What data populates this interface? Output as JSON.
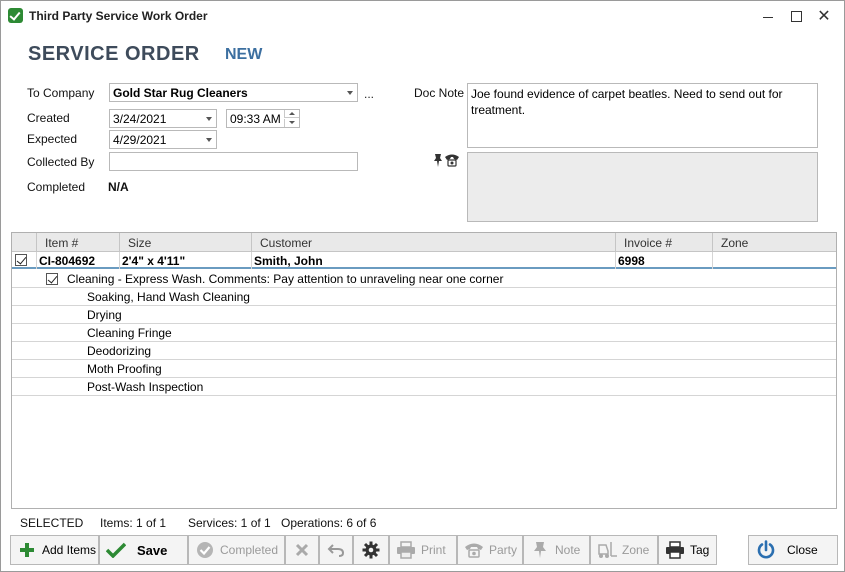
{
  "window": {
    "title": "Third Party Service Work Order"
  },
  "header": {
    "title": "SERVICE ORDER",
    "status": "NEW"
  },
  "form": {
    "to_company_label": "To Company",
    "to_company_value": "Gold Star Rug Cleaners",
    "ellipsis": "...",
    "created_label": "Created",
    "created_date": "3/24/2021",
    "created_time": "09:33 AM",
    "expected_label": "Expected",
    "expected_date": "4/29/2021",
    "collected_by_label": "Collected By",
    "collected_by_value": "",
    "completed_label": "Completed",
    "completed_value": "N/A",
    "doc_note_label": "Doc Note",
    "doc_note_value": "Joe found evidence of carpet beatles. Need to send out for treatment.",
    "secondary_note": ""
  },
  "grid": {
    "columns": [
      "Item #",
      "Size",
      "Customer",
      "Invoice #",
      "Zone"
    ],
    "row": {
      "item": "CI-804692",
      "size": "2'4\" x 4'11\"",
      "customer": "Smith, John",
      "invoice": "6998",
      "zone": ""
    },
    "service_line": "Cleaning - Express Wash.  Comments: Pay attention to unraveling near one corner",
    "operations": [
      "Soaking, Hand Wash Cleaning",
      "Drying",
      "Cleaning Fringe",
      "Deodorizing",
      "Moth Proofing",
      "Post-Wash Inspection"
    ]
  },
  "status_bar": {
    "selected": "SELECTED",
    "items": "Items: 1 of 1",
    "services": "Services: 1 of 1",
    "operations": "Operations: 6 of 6"
  },
  "toolbar": {
    "add_items": "Add Items",
    "save": "Save",
    "completed": "Completed",
    "print": "Print",
    "party": "Party",
    "note": "Note",
    "zone": "Zone",
    "tag": "Tag",
    "close": "Close"
  },
  "colors": {
    "title": "#3e4b5b",
    "status": "#3c6fa0",
    "accent_green": "#2d8a34",
    "close_blue": "#2b6fb0"
  }
}
